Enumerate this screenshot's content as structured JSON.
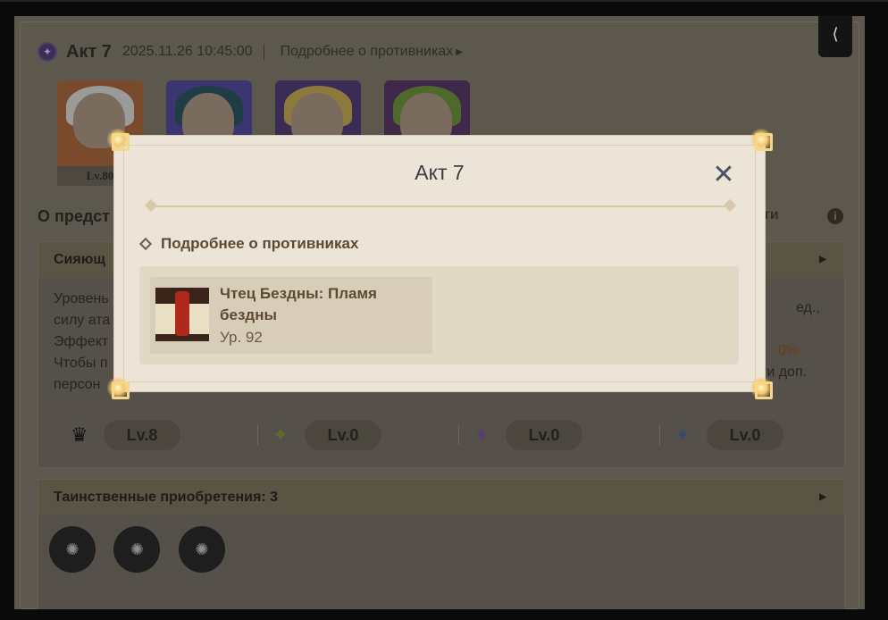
{
  "background_page": {
    "header": {
      "title": "Акт 7",
      "date": "2025.11.26 10:45:00",
      "link": "Подробнее о противниках"
    },
    "avatars": [
      {
        "name": "avatar-1"
      },
      {
        "name": "avatar-2"
      },
      {
        "name": "avatar-3"
      },
      {
        "name": "avatar-4"
      }
    ],
    "first_avatar_level": "Lv.80",
    "section_title": "О предст",
    "section_right": "бности",
    "panel_1": {
      "title": "Сияющ",
      "lines": [
        "Уровень",
        "силу ата",
        "Эффект",
        "Чтобы п",
        "персон"
      ],
      "right_lines": [
        "ед.,",
        "0%.",
        "ти доп."
      ]
    },
    "levels": [
      "Lv.8",
      "Lv.0",
      "Lv.0",
      "Lv.0"
    ],
    "panel_2": {
      "title": "Таинственные приобретения: 3"
    },
    "accent": "#a08d52"
  },
  "modal": {
    "title": "Акт 7",
    "subtitle": "Подробнее о противниках",
    "enemy": {
      "name": "Чтец Бездны: Пламя бездны",
      "level": "Ур. 92"
    }
  }
}
